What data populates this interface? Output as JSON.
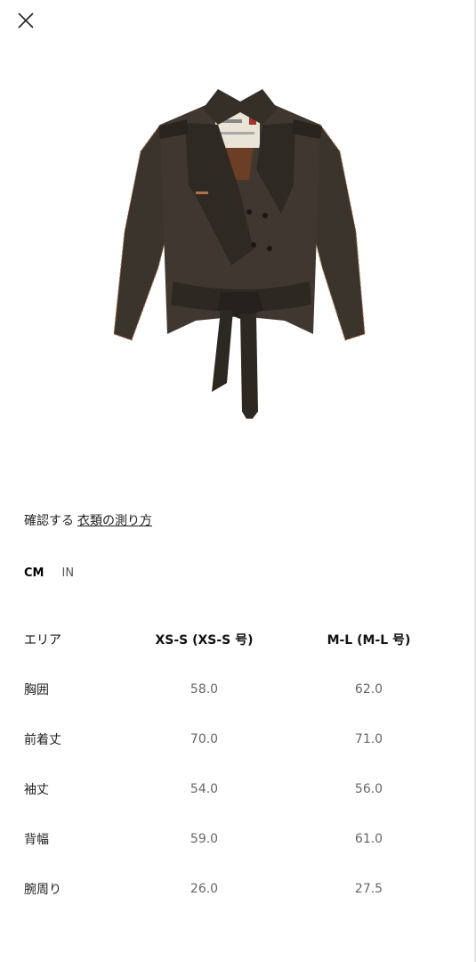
{
  "colors": {
    "text": "#111111",
    "muted": "#666666",
    "coat": "#3b342c",
    "stitch": "#b0744a"
  },
  "icons": {
    "close": "close-icon"
  },
  "measure": {
    "prefix": "確認する",
    "link": "衣類の測り方"
  },
  "units": {
    "active": "CM",
    "inactive": "IN"
  },
  "table": {
    "header": {
      "area": "エリア",
      "sizes": [
        "XS-S (XS-S 号)",
        "M-L (M-L 号)"
      ]
    },
    "rows": [
      {
        "label": "胸囲",
        "values": [
          "58.0",
          "62.0"
        ]
      },
      {
        "label": "前着丈",
        "values": [
          "70.0",
          "71.0"
        ]
      },
      {
        "label": "袖丈",
        "values": [
          "54.0",
          "56.0"
        ]
      },
      {
        "label": "背幅",
        "values": [
          "59.0",
          "61.0"
        ]
      },
      {
        "label": "腕周り",
        "values": [
          "26.0",
          "27.5"
        ]
      }
    ]
  }
}
